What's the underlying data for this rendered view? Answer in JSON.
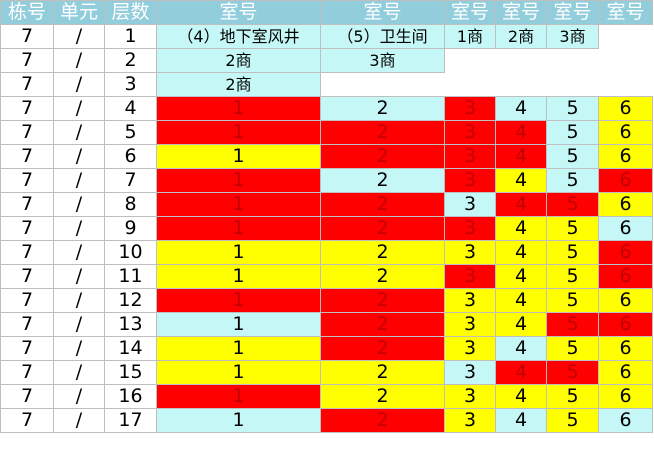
{
  "headers": [
    "栋号",
    "单元",
    "层数",
    "室号",
    "室号",
    "室号",
    "室号",
    "室号",
    "室号"
  ],
  "colors": {
    "header_bg": "#92cddc",
    "red": "#ff0000",
    "yellow": "#ffff00",
    "cyan": "#c6f7f7",
    "white": "#ffffff"
  },
  "sub_rows": [
    {
      "building": "7",
      "unit": "/",
      "floor": "1",
      "cells": [
        {
          "text": "（4）地下室风井",
          "color": "cyan",
          "span": 1
        },
        {
          "text": "（5）卫生间",
          "color": "cyan",
          "span": 1
        },
        {
          "text": "1商",
          "color": "cyan",
          "span": 1
        },
        {
          "text": "2商",
          "color": "cyan",
          "span": 1
        },
        {
          "text": "3商",
          "color": "cyan",
          "span": 1
        },
        {
          "text": "",
          "color": "white",
          "span": 1
        }
      ]
    },
    {
      "building": "7",
      "unit": "/",
      "floor": "2",
      "cells": [
        {
          "text": "2商",
          "color": "cyan",
          "span": 1
        },
        {
          "text": "3商",
          "color": "cyan",
          "span": 1
        },
        {
          "text": "",
          "color": "white",
          "span": 4
        }
      ]
    },
    {
      "building": "7",
      "unit": "/",
      "floor": "3",
      "cells": [
        {
          "text": "2商",
          "color": "cyan",
          "span": 1
        },
        {
          "text": "",
          "color": "white",
          "span": 5
        }
      ]
    }
  ],
  "rows": [
    {
      "building": "7",
      "unit": "/",
      "floor": "4",
      "colors": [
        "red",
        "cyan",
        "red",
        "cyan",
        "cyan",
        "yellow"
      ]
    },
    {
      "building": "7",
      "unit": "/",
      "floor": "5",
      "colors": [
        "red",
        "red",
        "red",
        "red",
        "cyan",
        "yellow"
      ]
    },
    {
      "building": "7",
      "unit": "/",
      "floor": "6",
      "colors": [
        "yellow",
        "red",
        "red",
        "red",
        "cyan",
        "yellow"
      ]
    },
    {
      "building": "7",
      "unit": "/",
      "floor": "7",
      "colors": [
        "red",
        "cyan",
        "red",
        "yellow",
        "cyan",
        "red"
      ]
    },
    {
      "building": "7",
      "unit": "/",
      "floor": "8",
      "colors": [
        "red",
        "red",
        "cyan",
        "red",
        "red",
        "yellow"
      ]
    },
    {
      "building": "7",
      "unit": "/",
      "floor": "9",
      "colors": [
        "red",
        "red",
        "red",
        "yellow",
        "yellow",
        "cyan"
      ]
    },
    {
      "building": "7",
      "unit": "/",
      "floor": "10",
      "colors": [
        "yellow",
        "yellow",
        "yellow",
        "yellow",
        "yellow",
        "red"
      ]
    },
    {
      "building": "7",
      "unit": "/",
      "floor": "11",
      "colors": [
        "yellow",
        "yellow",
        "red",
        "yellow",
        "yellow",
        "red"
      ]
    },
    {
      "building": "7",
      "unit": "/",
      "floor": "12",
      "colors": [
        "red",
        "red",
        "yellow",
        "yellow",
        "yellow",
        "yellow"
      ]
    },
    {
      "building": "7",
      "unit": "/",
      "floor": "13",
      "colors": [
        "cyan",
        "red",
        "yellow",
        "yellow",
        "red",
        "red"
      ]
    },
    {
      "building": "7",
      "unit": "/",
      "floor": "14",
      "colors": [
        "yellow",
        "red",
        "yellow",
        "cyan",
        "yellow",
        "yellow"
      ]
    },
    {
      "building": "7",
      "unit": "/",
      "floor": "15",
      "colors": [
        "yellow",
        "yellow",
        "cyan",
        "red",
        "red",
        "yellow"
      ]
    },
    {
      "building": "7",
      "unit": "/",
      "floor": "16",
      "colors": [
        "red",
        "yellow",
        "yellow",
        "yellow",
        "yellow",
        "yellow"
      ]
    },
    {
      "building": "7",
      "unit": "/",
      "floor": "17",
      "colors": [
        "cyan",
        "red",
        "yellow",
        "cyan",
        "yellow",
        "cyan"
      ]
    }
  ],
  "room_numbers": [
    "1",
    "2",
    "3",
    "4",
    "5",
    "6"
  ]
}
